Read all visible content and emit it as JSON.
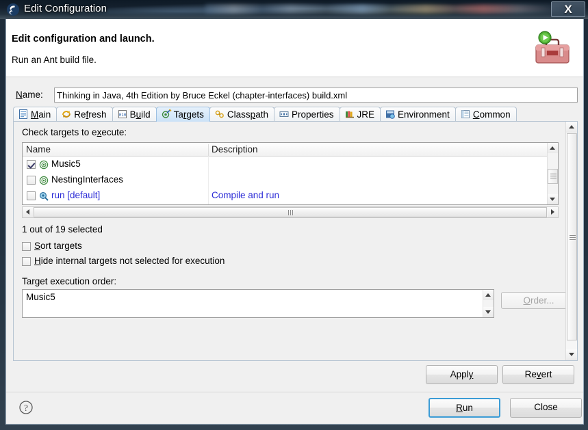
{
  "window": {
    "title": "Edit Configuration",
    "close_label": "X",
    "app_icon": "eclipse-launch-icon"
  },
  "header": {
    "title": "Edit configuration and launch.",
    "subtitle": "Run an Ant build file.",
    "icon": "ant-toolbox-run-icon"
  },
  "name_field": {
    "label": "Name:",
    "value": "Thinking in Java, 4th Edition by Bruce Eckel (chapter-interfaces) build.xml"
  },
  "tabs": [
    {
      "label": "Main",
      "icon": "document-icon",
      "active": false
    },
    {
      "label": "Refresh",
      "icon": "refresh-icon",
      "active": false
    },
    {
      "label": "Build",
      "icon": "binary-icon",
      "active": false
    },
    {
      "label": "Targets",
      "icon": "targets-icon",
      "active": true
    },
    {
      "label": "Classpath",
      "icon": "classpath-icon",
      "active": false
    },
    {
      "label": "Properties",
      "icon": "properties-icon",
      "active": false
    },
    {
      "label": "JRE",
      "icon": "jre-icon",
      "active": false
    },
    {
      "label": "Environment",
      "icon": "environment-icon",
      "active": false
    },
    {
      "label": "Common",
      "icon": "common-icon",
      "active": false
    }
  ],
  "targets": {
    "check_label": "Check targets to execute:",
    "columns": [
      "Name",
      "Description"
    ],
    "rows": [
      {
        "checked": true,
        "name": "Music5",
        "description": "",
        "icon": "target-icon",
        "style": "normal"
      },
      {
        "checked": false,
        "name": "NestingInterfaces",
        "description": "",
        "icon": "target-icon",
        "style": "normal"
      },
      {
        "checked": false,
        "name": "run [default]",
        "description": "Compile and run",
        "icon": "default-target-icon",
        "style": "blue"
      }
    ],
    "count_text": "1 out of 19 selected",
    "options": [
      {
        "label": "Sort targets",
        "checked": false
      },
      {
        "label": "Hide internal targets not selected for execution",
        "checked": false
      }
    ],
    "order_label": "Target execution order:",
    "order_items": [
      "Music5"
    ],
    "order_button": "Order..."
  },
  "buttons": {
    "apply": "Apply",
    "revert": "Revert",
    "run": "Run",
    "close": "Close",
    "help_icon": "help-question-icon"
  },
  "colors": {
    "link_blue": "#2b2bd6",
    "active_tab": "#cbe2f7",
    "default_button_border": "#3c9cd6",
    "titlebar": "#15212e"
  }
}
